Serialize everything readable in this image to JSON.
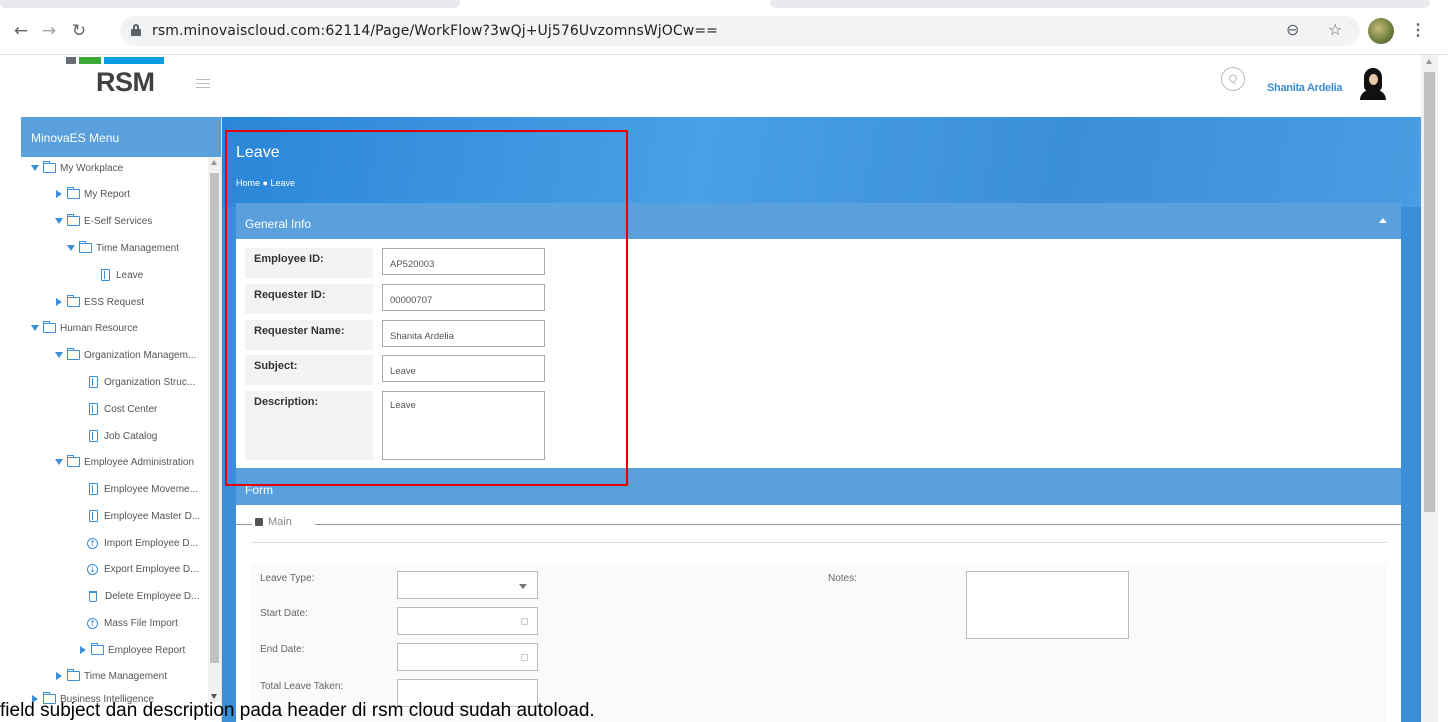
{
  "browser": {
    "url": "rsm.minovaiscloud.com:62114/Page/WorkFlow?3wQj+Uj576UvzomnsWjOCw==",
    "back_icon": "arrow-left",
    "forward_icon": "arrow-right",
    "reload_icon": "reload",
    "zoom_icon": "zoom",
    "star_icon": "star",
    "menu_icon": "kebab"
  },
  "header": {
    "logo_text": "RSM",
    "user_name": "Shanita Ardelia",
    "colors": {
      "brand_blue": "#009cde",
      "brand_green": "#3aa935",
      "brand_gray": "#6b6e70"
    }
  },
  "sidebar": {
    "title": "MinovaES Menu",
    "items": [
      {
        "label": "My Workplace",
        "icon": "folder-open-icon"
      },
      {
        "label": "My Report",
        "icon": "folder-icon"
      },
      {
        "label": "E-Self Services",
        "icon": "folder-open-icon"
      },
      {
        "label": "Time Management",
        "icon": "folder-open-icon"
      },
      {
        "label": "Leave",
        "icon": "page-icon"
      },
      {
        "label": "ESS Request",
        "icon": "folder-icon"
      },
      {
        "label": "Human Resource",
        "icon": "folder-open-icon"
      },
      {
        "label": "Organization Managem...",
        "icon": "folder-open-icon"
      },
      {
        "label": "Organization Struc...",
        "icon": "page-icon"
      },
      {
        "label": "Cost Center",
        "icon": "page-icon"
      },
      {
        "label": "Job Catalog",
        "icon": "page-icon"
      },
      {
        "label": "Employee Administration",
        "icon": "folder-open-icon"
      },
      {
        "label": "Employee Moveme...",
        "icon": "page-icon"
      },
      {
        "label": "Employee Master D...",
        "icon": "page-icon"
      },
      {
        "label": "Import Employee D...",
        "icon": "upload-icon"
      },
      {
        "label": "Export Employee D...",
        "icon": "download-icon"
      },
      {
        "label": "Delete Employee D...",
        "icon": "trash-icon"
      },
      {
        "label": "Mass File Import",
        "icon": "upload-icon"
      },
      {
        "label": "Employee Report",
        "icon": "folder-icon"
      },
      {
        "label": "Time Management",
        "icon": "folder-icon"
      },
      {
        "label": "Business Intelligence",
        "icon": "folder-icon"
      }
    ]
  },
  "main": {
    "title": "Leave",
    "breadcrumb": "Home ● Leave",
    "general_info": {
      "header": "General Info",
      "fields": [
        {
          "label": "Employee ID:",
          "value": "AP520003"
        },
        {
          "label": "Requester ID:",
          "value": "00000707"
        },
        {
          "label": "Requester Name:",
          "value": "Shanita Ardelia"
        },
        {
          "label": "Subject:",
          "value": "Leave"
        },
        {
          "label": "Description:",
          "value": "Leave"
        }
      ]
    },
    "form": {
      "header": "Form",
      "legend": "Main",
      "labels": {
        "leave_type": "Leave Type:",
        "start_date": "Start Date:",
        "end_date": "End Date:",
        "total_leave": "Total Leave Taken:",
        "notes": "Notes:"
      }
    }
  },
  "caption": "field subject dan description pada header di rsm cloud sudah autoload."
}
